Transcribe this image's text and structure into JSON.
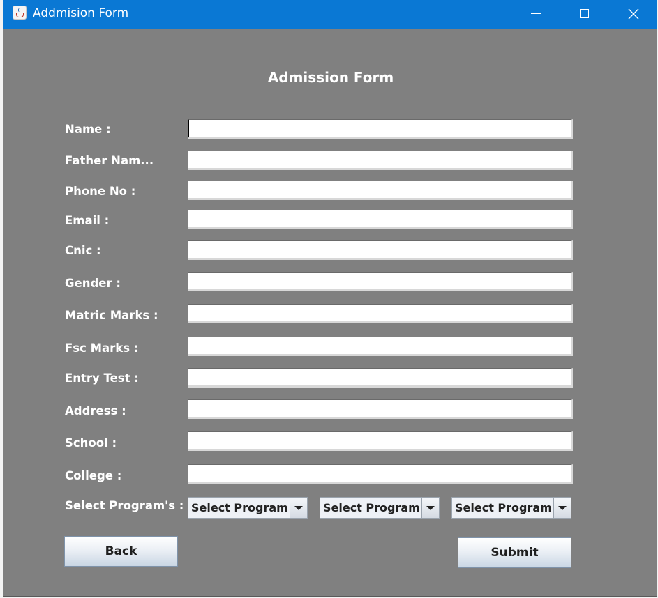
{
  "window": {
    "title": "Addmision Form"
  },
  "form": {
    "heading": "Admission Form",
    "fields": [
      {
        "label": "Name :",
        "value": ""
      },
      {
        "label": "Father Nam...",
        "value": ""
      },
      {
        "label": "Phone No :",
        "value": ""
      },
      {
        "label": "Email :",
        "value": ""
      },
      {
        "label": "Cnic :",
        "value": ""
      },
      {
        "label": "Gender :",
        "value": ""
      },
      {
        "label": "Matric Marks :",
        "value": ""
      },
      {
        "label": "Fsc Marks :",
        "value": ""
      },
      {
        "label": "Entry Test :",
        "value": ""
      },
      {
        "label": "Address :",
        "value": ""
      },
      {
        "label": "School :",
        "value": ""
      },
      {
        "label": "College :",
        "value": ""
      }
    ],
    "programs_label": "Select Program's :",
    "programs": [
      {
        "selected": "Select Program"
      },
      {
        "selected": "Select Program"
      },
      {
        "selected": "Select Program"
      }
    ],
    "back_label": "Back",
    "submit_label": "Submit"
  }
}
